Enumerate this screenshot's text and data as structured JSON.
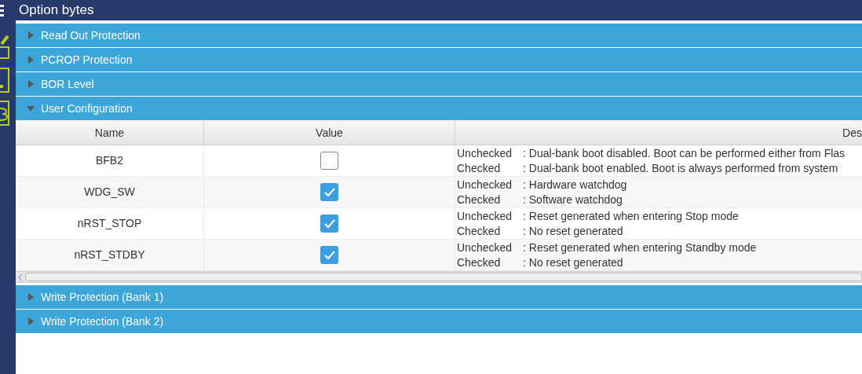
{
  "window": {
    "title": "Option bytes"
  },
  "sections": [
    {
      "title": "Read Out Protection",
      "expanded": false
    },
    {
      "title": "PCROP Protection",
      "expanded": false
    },
    {
      "title": "BOR Level",
      "expanded": false
    },
    {
      "title": "User Configuration",
      "expanded": true,
      "table": {
        "columns": [
          "Name",
          "Value",
          "Des"
        ],
        "rows": [
          {
            "name": "BFB2",
            "checked": false,
            "lines": [
              {
                "label": "Unchecked",
                "text": ": Dual-bank boot disabled. Boot can be performed either from Flas"
              },
              {
                "label": "Checked",
                "text": ": Dual-bank boot enabled. Boot is always performed from system"
              }
            ]
          },
          {
            "name": "WDG_SW",
            "checked": true,
            "lines": [
              {
                "label": "Unchecked",
                "text": ": Hardware watchdog"
              },
              {
                "label": "Checked",
                "text": ": Software watchdog"
              }
            ]
          },
          {
            "name": "nRST_STOP",
            "checked": true,
            "lines": [
              {
                "label": "Unchecked",
                "text": ": Reset generated when entering Stop mode"
              },
              {
                "label": "Checked",
                "text": ": No reset generated"
              }
            ]
          },
          {
            "name": "nRST_STDBY",
            "checked": true,
            "lines": [
              {
                "label": "Unchecked",
                "text": ": Reset generated when entering Standby mode"
              },
              {
                "label": "Checked",
                "text": ": No reset generated"
              }
            ]
          }
        ]
      }
    },
    {
      "title": "Write Protection (Bank 1)",
      "expanded": false
    },
    {
      "title": "Write Protection (Bank 2)",
      "expanded": false
    }
  ]
}
